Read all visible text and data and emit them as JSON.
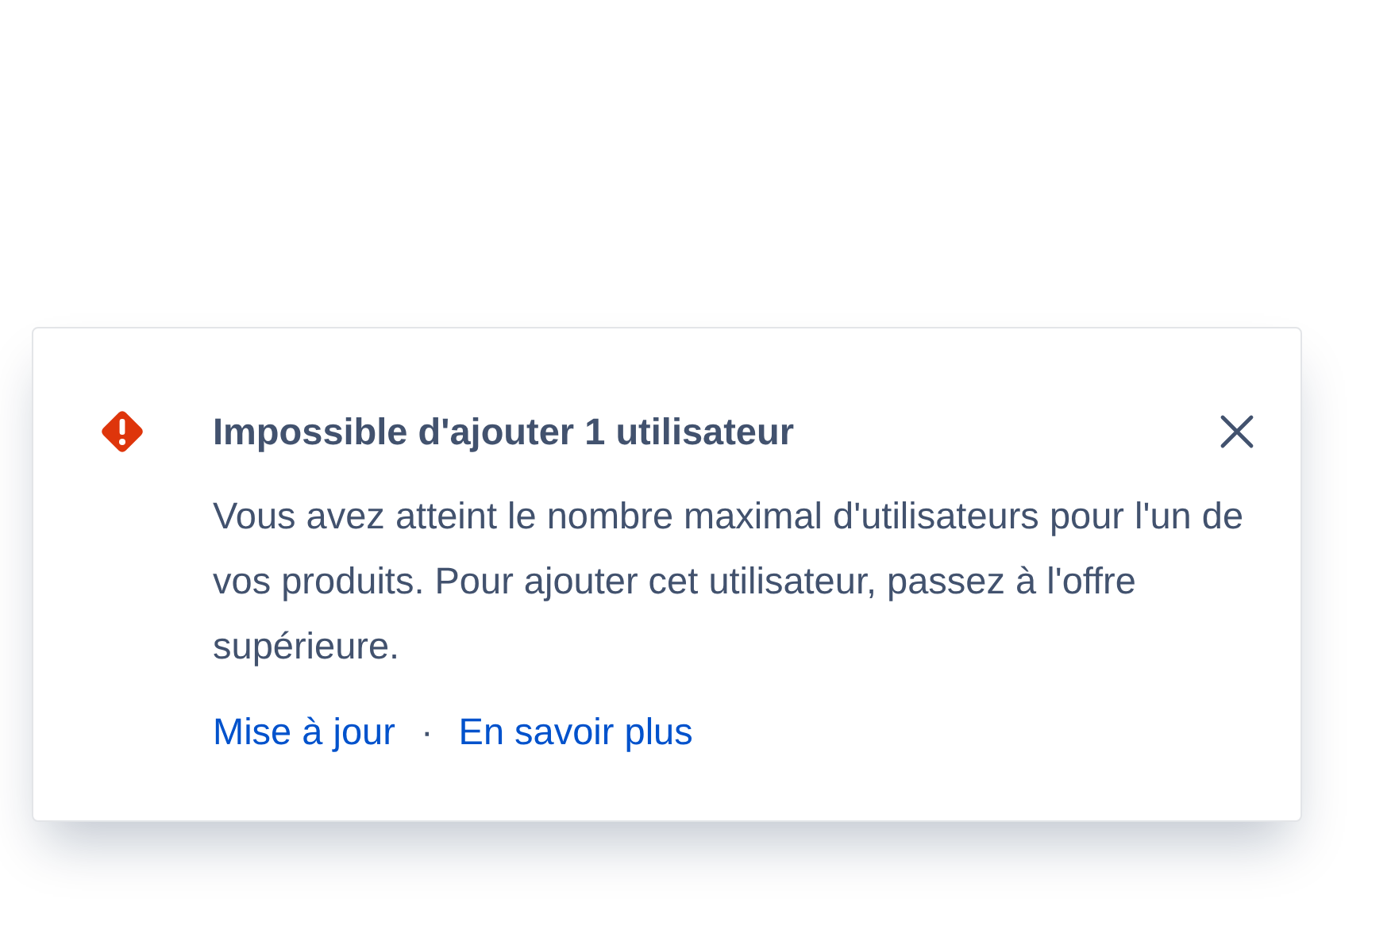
{
  "flag": {
    "title": "Impossible d'ajouter 1 utilisateur",
    "message": "Vous avez atteint le nombre maximal d'utilisateurs pour l'un de vos produits. Pour ajouter cet utilisateur, passez à l'offre supérieure.",
    "actions": [
      {
        "label": "Mise à jour"
      },
      {
        "label": "En savoir plus"
      }
    ],
    "separator": "·"
  }
}
